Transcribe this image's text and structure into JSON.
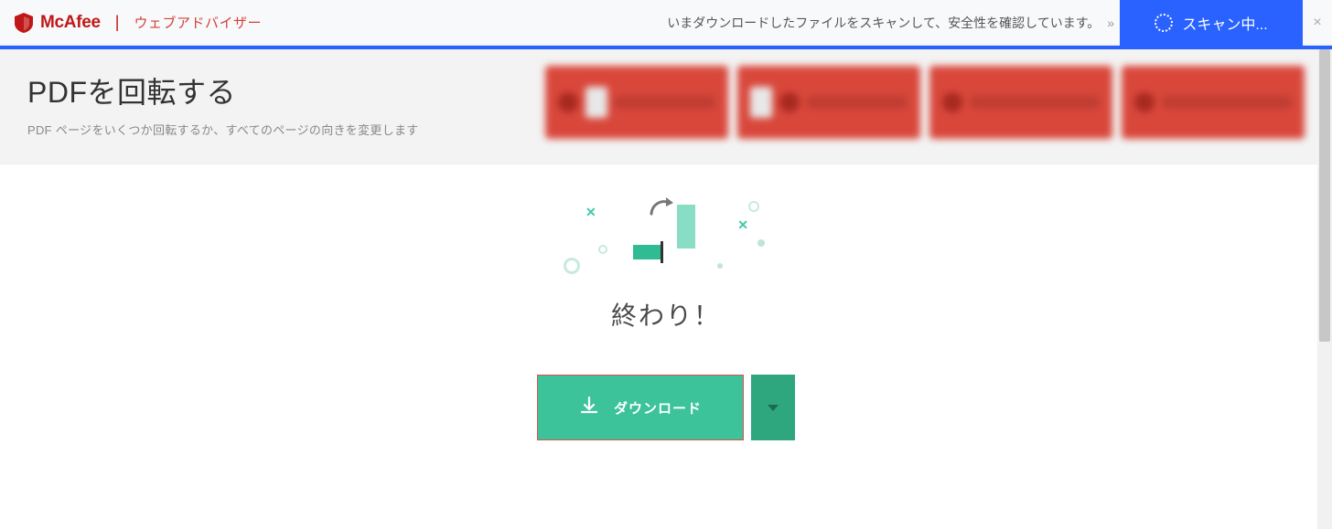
{
  "mcafee": {
    "brand": "McAfee",
    "advisor_label": "ウェブアドバイザー",
    "status_text": "いまダウンロードしたファイルをスキャンして、安全性を確認しています。",
    "status_chevrons": "»",
    "scanning_label": "スキャン中...",
    "close_glyph": "×"
  },
  "header": {
    "title": "PDFを回転する",
    "subtitle": "PDF ページをいくつか回転するか、すべてのページの向きを変更します"
  },
  "main": {
    "done_label": "終わり！",
    "download_label": "ダウンロード"
  },
  "decor": {
    "x_glyph": "✕"
  },
  "colors": {
    "mcafee_red": "#c01818",
    "scan_blue": "#2962ff",
    "primary_green": "#3cc39a",
    "dropdown_green": "#2ea77f",
    "highlight_border": "#d9534f"
  }
}
